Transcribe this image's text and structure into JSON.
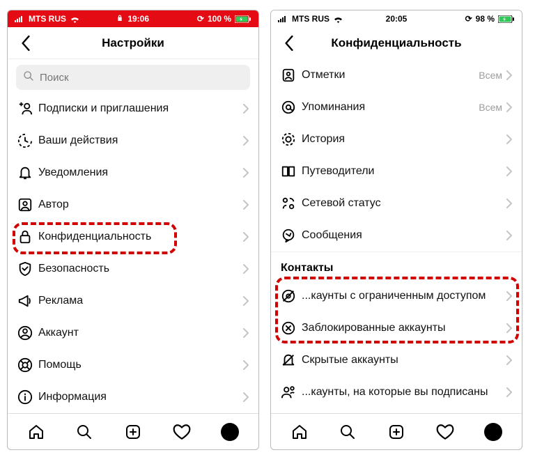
{
  "left": {
    "statusbar": {
      "carrier": "MTS RUS",
      "time": "19:06",
      "battery": "100 %"
    },
    "title": "Настройки",
    "search_placeholder": "Поиск",
    "items": [
      {
        "icon": "person-plus-icon",
        "label": "Подписки и приглашения"
      },
      {
        "icon": "activity-icon",
        "label": "Ваши действия"
      },
      {
        "icon": "bell-icon",
        "label": "Уведомления"
      },
      {
        "icon": "author-icon",
        "label": "Автор"
      },
      {
        "icon": "lock-icon",
        "label": "Конфиденциальность",
        "highlight": true
      },
      {
        "icon": "shield-icon",
        "label": "Безопасность"
      },
      {
        "icon": "megaphone-icon",
        "label": "Реклама"
      },
      {
        "icon": "account-icon",
        "label": "Аккаунт"
      },
      {
        "icon": "help-icon",
        "label": "Помощь"
      },
      {
        "icon": "info-icon",
        "label": "Информация"
      }
    ]
  },
  "right": {
    "statusbar": {
      "carrier": "MTS RUS",
      "time": "20:05",
      "battery": "98 %"
    },
    "title": "Конфиденциальность",
    "items": [
      {
        "icon": "tag-icon",
        "label": "Отметки",
        "value": "Всем"
      },
      {
        "icon": "mention-icon",
        "label": "Упоминания",
        "value": "Всем"
      },
      {
        "icon": "story-icon",
        "label": "История"
      },
      {
        "icon": "guides-icon",
        "label": "Путеводители"
      },
      {
        "icon": "status-icon",
        "label": "Сетевой статус"
      },
      {
        "icon": "messages-icon",
        "label": "Сообщения"
      }
    ],
    "section": "Контакты",
    "contacts": [
      {
        "icon": "restricted-icon",
        "label": "...каунты с ограниченным доступом",
        "highlight": true
      },
      {
        "icon": "blocked-icon",
        "label": "Заблокированные аккаунты",
        "highlight": true
      },
      {
        "icon": "muted-icon",
        "label": "Скрытые аккаунты"
      },
      {
        "icon": "following-icon",
        "label": "...каунты, на которые вы подписаны"
      }
    ]
  }
}
